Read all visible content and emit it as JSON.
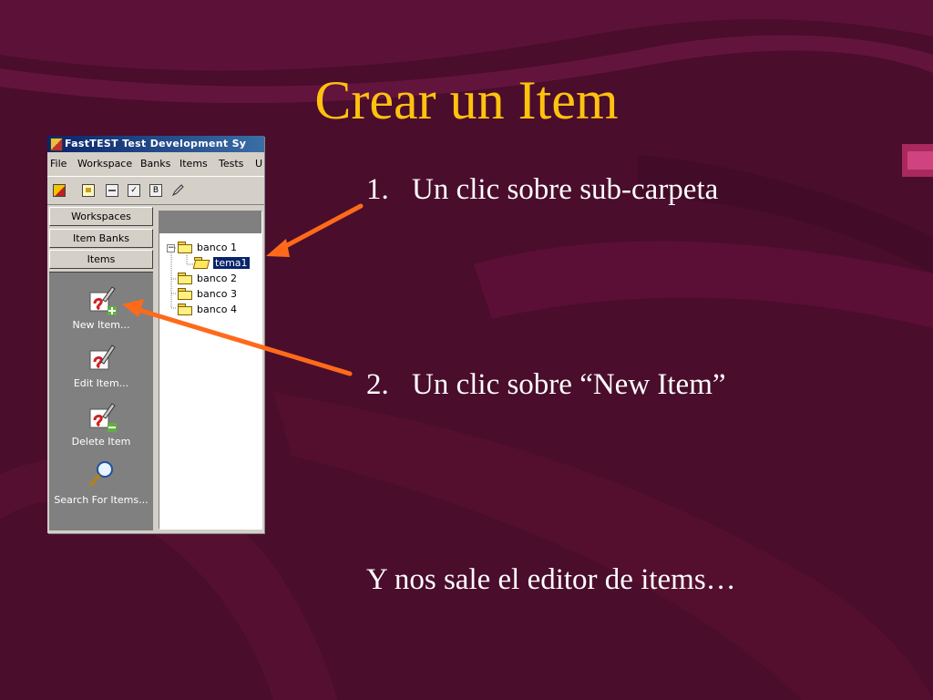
{
  "slide": {
    "title": "Crear un Item",
    "steps": [
      {
        "number": "1.",
        "text": "Un clic sobre sub-carpeta"
      },
      {
        "number": "2.",
        "text": "Un clic sobre “New Item”"
      }
    ],
    "footer": "Y nos sale el editor de items…"
  },
  "colors": {
    "background": "#4a0d2c",
    "title": "#ffc20e",
    "body_text": "#ffffff",
    "arrow": "#ff6a1a"
  },
  "app": {
    "window_title": "FastTEST Test Development Sy",
    "menu": [
      "File",
      "Workspace",
      "Banks",
      "Items",
      "Tests",
      "U"
    ],
    "toolbar_icons": [
      "app-icon",
      "open-icon",
      "list-icon",
      "check-icon",
      "b-icon",
      "pen-icon"
    ],
    "toolbar_b_label": "B",
    "nav_buttons": [
      "Workspaces",
      "Item Banks",
      "Items"
    ],
    "item_actions": [
      {
        "label": "New Item...",
        "icon": "new-item-icon"
      },
      {
        "label": "Edit Item...",
        "icon": "edit-item-icon"
      },
      {
        "label": "Delete Item",
        "icon": "delete-item-icon"
      },
      {
        "label": "Search For Items...",
        "icon": "search-items-icon"
      }
    ],
    "tree": {
      "expander": "−",
      "nodes": [
        {
          "label": "banco 1",
          "expanded": true
        },
        {
          "label": "tema1",
          "selected": true,
          "child_of": "banco 1"
        },
        {
          "label": "banco 2"
        },
        {
          "label": "banco 3"
        },
        {
          "label": "banco 4"
        }
      ]
    }
  }
}
